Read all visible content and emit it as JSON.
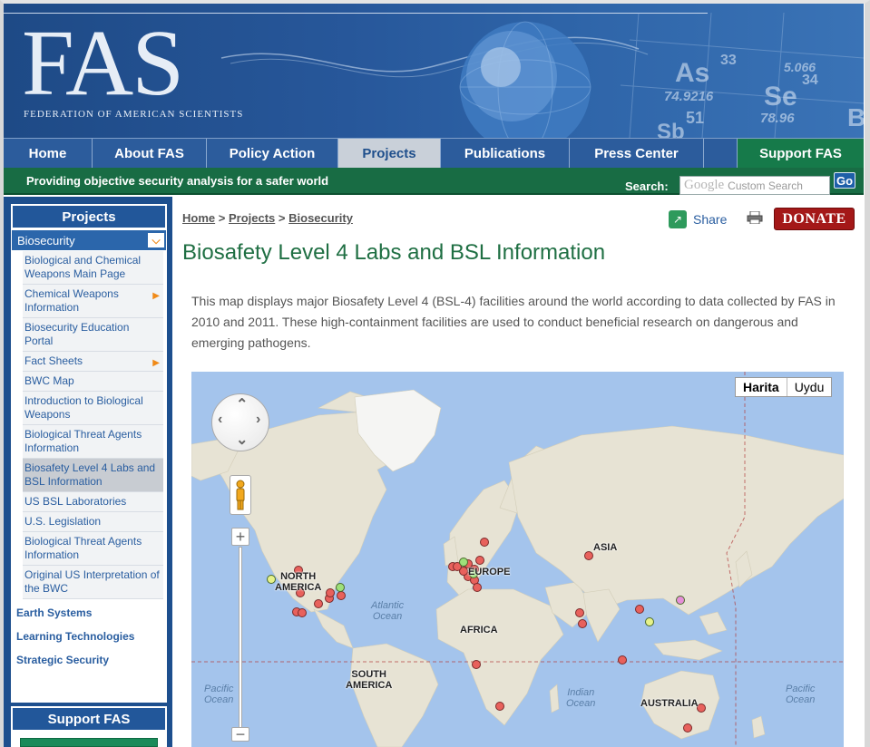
{
  "header": {
    "logo": "FAS",
    "logo_subtitle": "FEDERATION OF AMERICAN SCIENTISTS",
    "periodic": [
      "As",
      "33",
      "74.9216",
      "Se",
      "34",
      "78.96",
      "51",
      "Sb",
      "Br",
      "5.066"
    ]
  },
  "nav": {
    "tabs": [
      {
        "label": "Home",
        "active": false
      },
      {
        "label": "About FAS",
        "active": false
      },
      {
        "label": "Policy Action",
        "active": false
      },
      {
        "label": "Projects",
        "active": true
      },
      {
        "label": "Publications",
        "active": false
      },
      {
        "label": "Press Center",
        "active": false
      }
    ],
    "support": "Support FAS"
  },
  "tagbar": {
    "tagline": "Providing objective security analysis for a safer world",
    "search_label": "Search:",
    "search_google": "Google",
    "search_placeholder": "Custom Search",
    "search_go": "Go"
  },
  "sidebar": {
    "heading": "Projects",
    "section": "Biosecurity",
    "items": [
      {
        "label": "Biological and Chemical Weapons Main Page",
        "arrow": false,
        "active": false
      },
      {
        "label": "Chemical Weapons Information",
        "arrow": true,
        "active": false
      },
      {
        "label": "Biosecurity Education Portal",
        "arrow": false,
        "active": false
      },
      {
        "label": "Fact Sheets",
        "arrow": true,
        "active": false
      },
      {
        "label": "BWC Map",
        "arrow": false,
        "active": false
      },
      {
        "label": "Introduction to Biological Weapons",
        "arrow": false,
        "active": false
      },
      {
        "label": "Biological Threat Agents Information",
        "arrow": false,
        "active": false
      },
      {
        "label": "Biosafety Level 4 Labs and BSL Information",
        "arrow": false,
        "active": true
      },
      {
        "label": "US BSL Laboratories",
        "arrow": false,
        "active": false
      },
      {
        "label": "U.S. Legislation",
        "arrow": false,
        "active": false
      },
      {
        "label": "Biological Threat Agents Information",
        "arrow": false,
        "active": false
      },
      {
        "label": "Original US Interpretation of the BWC",
        "arrow": false,
        "active": false
      }
    ],
    "top_links": [
      "Earth Systems",
      "Learning Technologies",
      "Strategic Security"
    ],
    "support": "Support FAS"
  },
  "main": {
    "breadcrumb": [
      "Home",
      "Projects",
      "Biosecurity"
    ],
    "breadcrumb_sep": ">",
    "share": "Share",
    "donate": "DONATE",
    "title": "Biosafety Level 4 Labs and BSL Information",
    "intro": "This map displays major Biosafety Level 4 (BSL-4) facilities around the world according to data collected by FAS in 2010 and 2011. These high-containment facilities are used to conduct beneficial research on dangerous and emerging pathogens."
  },
  "map": {
    "type_map": "Harita",
    "type_satellite": "Uydu",
    "zoom_in": "+",
    "zoom_out": "−",
    "labels": {
      "north_america": "NORTH\nAMERICA",
      "south_america": "SOUTH\nAMERICA",
      "europe": "EUROPE",
      "africa": "AFRICA",
      "asia": "ASIA",
      "australia": "AUSTRALIA",
      "atlantic": "Atlantic\nOcean",
      "pacific_w": "Pacific\nOcean",
      "pacific_e": "Pacific\nOcean",
      "indian": "Indian\nOcean"
    },
    "marker_colors": {
      "red": "#e8615c",
      "green": "#9ee07a",
      "yellow": "#e6f28a",
      "pink": "#e58fd8"
    },
    "land_color": "#e8e4d6",
    "water_color": "#a4c4ec"
  }
}
